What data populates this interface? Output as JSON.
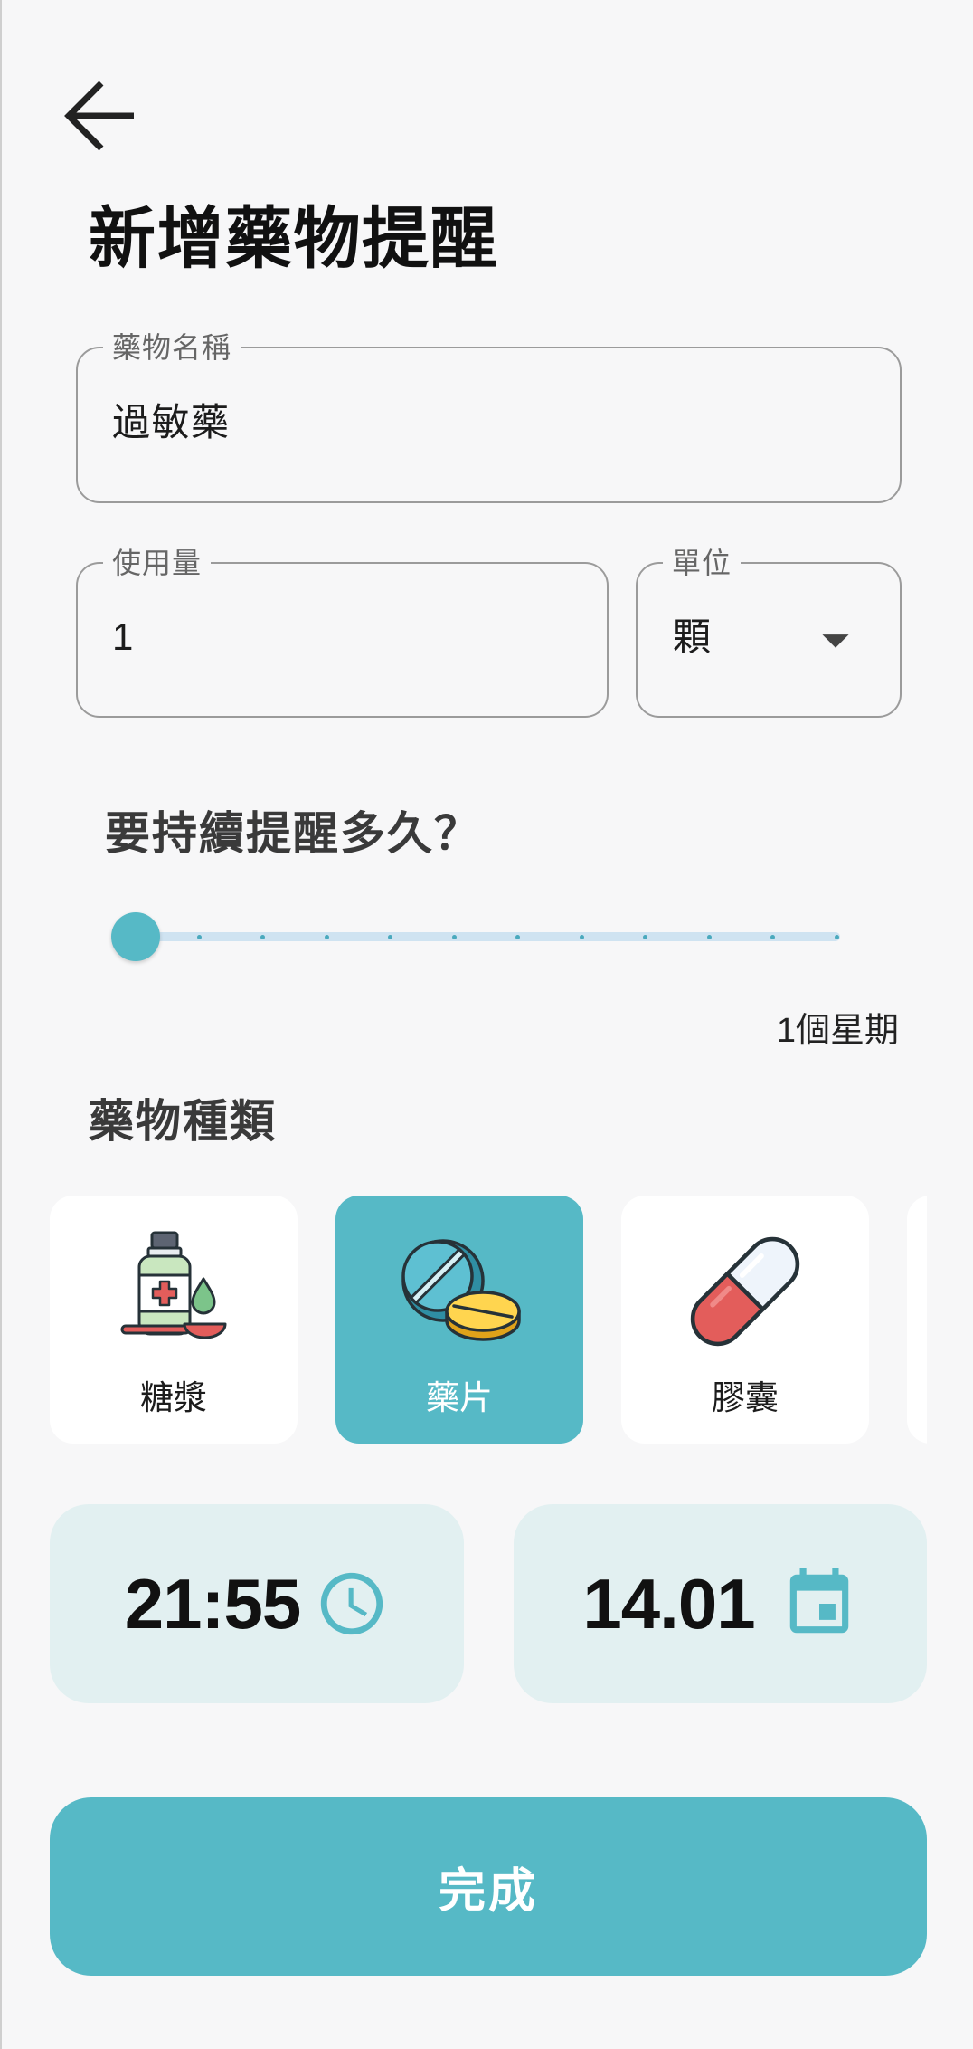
{
  "header": {
    "back_icon": "arrow-left-icon",
    "title": "新增藥物提醒"
  },
  "form": {
    "name": {
      "label": "藥物名稱",
      "value": "過敏藥"
    },
    "dosage": {
      "label": "使用量",
      "value": "1"
    },
    "unit": {
      "label": "單位",
      "value": "顆",
      "icon": "dropdown-arrow-icon"
    }
  },
  "duration": {
    "heading": "要持續提醒多久？",
    "min": 1,
    "max": 12,
    "value": 1,
    "value_label": "1個星期"
  },
  "medicine_type": {
    "heading": "藥物種類",
    "items": [
      {
        "label": "糖漿",
        "icon": "syrup-bottle-icon",
        "selected": false
      },
      {
        "label": "藥片",
        "icon": "pills-icon",
        "selected": true
      },
      {
        "label": "膠囊",
        "icon": "capsule-icon",
        "selected": false
      }
    ]
  },
  "schedule": {
    "time": "21:55",
    "time_icon": "clock-icon",
    "date": "14.01",
    "date_icon": "calendar-icon"
  },
  "submit": {
    "label": "完成"
  },
  "colors": {
    "accent": "#56b9c6",
    "accent_light": "#e2f0f1",
    "background": "#f7f7f8",
    "slider_track": "#cfe3f1"
  }
}
